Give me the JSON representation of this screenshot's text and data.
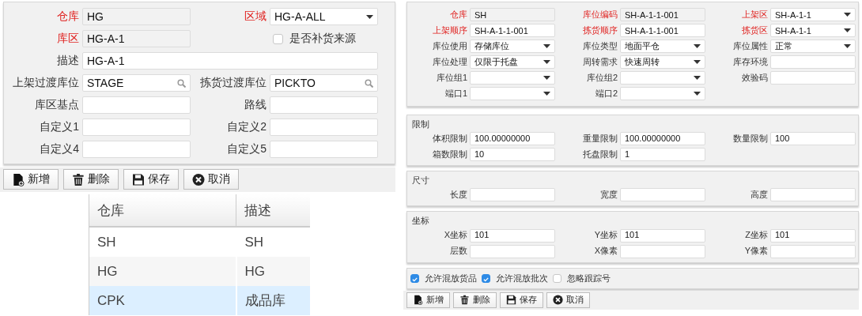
{
  "zone_form": {
    "fields": [
      {
        "kind": "readonly",
        "label": "仓库",
        "required": true,
        "value": "HG"
      },
      {
        "kind": "select",
        "label": "区域",
        "required": true,
        "value": "HG-A-ALL"
      },
      {
        "kind": "readonly",
        "label": "库区",
        "required": true,
        "value": "HG-A-1"
      },
      {
        "kind": "checkbox",
        "label": "是否补货来源",
        "checked": false
      },
      {
        "kind": "wide",
        "label": "描述",
        "required": false,
        "value": "HG-A-1"
      },
      {
        "kind": "search",
        "label": "上架过渡库位",
        "required": false,
        "value": "STAGE"
      },
      {
        "kind": "search",
        "label": "拣货过渡库位",
        "required": false,
        "value": "PICKTO"
      },
      {
        "kind": "text",
        "label": "库区基点",
        "required": false
      },
      {
        "kind": "text",
        "label": "路线",
        "required": false
      },
      {
        "kind": "text",
        "label": "自定义1",
        "required": false
      },
      {
        "kind": "text",
        "label": "自定义2",
        "required": false
      },
      {
        "kind": "text",
        "label": "自定义4",
        "required": false
      },
      {
        "kind": "text",
        "label": "自定义5",
        "required": false
      }
    ]
  },
  "zone_toolbar": [
    {
      "kind": "new",
      "label": "新增"
    },
    {
      "kind": "delete",
      "label": "删除"
    },
    {
      "kind": "save",
      "label": "保存"
    },
    {
      "kind": "cancel",
      "label": "取消"
    }
  ],
  "warehouse_table": {
    "columns": [
      "仓库",
      "描述"
    ],
    "rows": [
      {
        "cells": [
          "SH",
          "SH"
        ],
        "selected": false
      },
      {
        "cells": [
          "HG",
          "HG"
        ],
        "selected": false
      },
      {
        "cells": [
          "CPK",
          "成品库"
        ],
        "selected": true
      }
    ]
  },
  "location_form": {
    "fields": [
      {
        "kind": "readonly",
        "label": "仓库",
        "required": true,
        "value": "SH"
      },
      {
        "kind": "readonly",
        "label": "库位编码",
        "required": true,
        "value": "SH-A-1-1-001"
      },
      {
        "kind": "select",
        "label": "上架区",
        "required": true,
        "value": "SH-A-1-1"
      },
      {
        "kind": "text",
        "label": "上架顺序",
        "required": true,
        "value": "SH-A-1-1-001"
      },
      {
        "kind": "text",
        "label": "拣货顺序",
        "required": true,
        "value": "SH-A-1-1-001"
      },
      {
        "kind": "select",
        "label": "拣货区",
        "required": true,
        "value": "SH-A-1-1"
      },
      {
        "kind": "select",
        "label": "库位使用",
        "required": false,
        "value": "存储库位"
      },
      {
        "kind": "select",
        "label": "库位类型",
        "required": false,
        "value": "地面平仓"
      },
      {
        "kind": "select",
        "label": "库位属性",
        "required": false,
        "value": "正常"
      },
      {
        "kind": "select",
        "label": "库位处理",
        "required": false,
        "value": "仅限于托盘"
      },
      {
        "kind": "select",
        "label": "周转需求",
        "required": false,
        "value": "快速周转"
      },
      {
        "kind": "text",
        "label": "库存环境",
        "required": false
      },
      {
        "kind": "select",
        "label": "库位组1",
        "required": false
      },
      {
        "kind": "select",
        "label": "库位组2",
        "required": false
      },
      {
        "kind": "text",
        "label": "效验码",
        "required": false
      },
      {
        "kind": "select",
        "label": "端口1",
        "required": false
      },
      {
        "kind": "select",
        "label": "端口2",
        "required": false
      }
    ]
  },
  "sections": [
    {
      "title": "限制",
      "fields": [
        {
          "kind": "text",
          "label": "体积限制",
          "required": false,
          "value": "100.00000000"
        },
        {
          "kind": "text",
          "label": "重量限制",
          "required": false,
          "value": "100.00000000"
        },
        {
          "kind": "text",
          "label": "数量限制",
          "required": false,
          "value": "100"
        },
        {
          "kind": "text",
          "label": "箱数限制",
          "required": false,
          "value": "10"
        },
        {
          "kind": "text",
          "label": "托盘限制",
          "required": false,
          "value": "1"
        }
      ]
    },
    {
      "title": "尺寸",
      "fields": [
        {
          "kind": "text",
          "label": "长度",
          "required": false
        },
        {
          "kind": "text",
          "label": "宽度",
          "required": false
        },
        {
          "kind": "text",
          "label": "高度",
          "required": false
        }
      ]
    },
    {
      "title": "坐标",
      "fields": [
        {
          "kind": "text",
          "label": "X坐标",
          "required": false,
          "value": "101"
        },
        {
          "kind": "text",
          "label": "Y坐标",
          "required": false,
          "value": "101"
        },
        {
          "kind": "text",
          "label": "Z坐标",
          "required": false,
          "value": "101"
        },
        {
          "kind": "text",
          "label": "层数",
          "required": false
        },
        {
          "kind": "text",
          "label": "X像素",
          "required": false
        },
        {
          "kind": "text",
          "label": "Y像素",
          "required": false
        }
      ]
    }
  ],
  "location_options": [
    {
      "label": "允许混放货品",
      "checked": true
    },
    {
      "label": "允许混放批次",
      "checked": true
    },
    {
      "label": "忽略跟踪号",
      "checked": false
    }
  ],
  "location_toolbar": [
    {
      "kind": "new",
      "label": "新增"
    },
    {
      "kind": "delete",
      "label": "删除"
    },
    {
      "kind": "save",
      "label": "保存"
    },
    {
      "kind": "cancel",
      "label": "取消"
    }
  ]
}
